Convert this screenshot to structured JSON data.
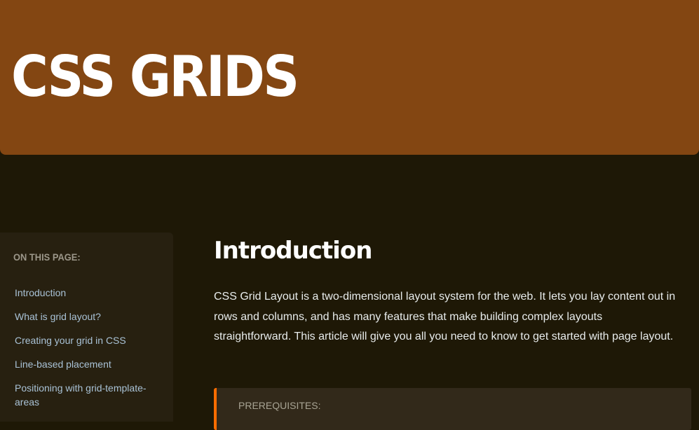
{
  "hero": {
    "title": "CSS GRIDS"
  },
  "sidebar": {
    "heading": "ON THIS PAGE:",
    "items": [
      {
        "label": "Introduction"
      },
      {
        "label": "What is grid layout?"
      },
      {
        "label": "Creating your grid in CSS"
      },
      {
        "label": "Line-based placement"
      },
      {
        "label": "Positioning with grid-template-areas"
      }
    ]
  },
  "main": {
    "heading": "Introduction",
    "paragraph": "CSS Grid Layout is a two-dimensional layout system for the web. It lets you lay content out in rows and columns, and has many features that make building complex layouts straightforward. This article will give you all you need to know to get started with page layout.",
    "prerequisites_label": "PREREQUISITES:"
  },
  "colors": {
    "hero": "#834612",
    "background": "#1e1806",
    "accent": "#ff6d00",
    "link": "#a9c2d6"
  }
}
